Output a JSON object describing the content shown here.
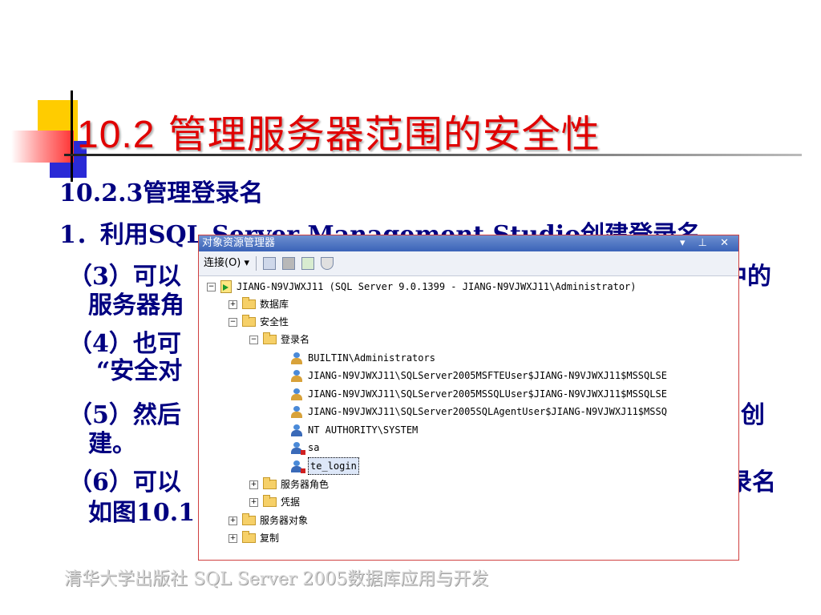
{
  "slide": {
    "title_num": "10.2",
    "title_text": "管理服务器范围的安全性",
    "subhead": "10.2.3管理登录名",
    "line1": "1．利用SQL Server Management Studio创建登录名",
    "p3_prefix": "（3）可以",
    "p3_suffix": "中的",
    "p3_line2": "服务器角",
    "p4_prefix": "（4）也可",
    "p4_line2": "“安全对",
    "p5_prefix": "（5）然后",
    "p5_suffix": "创",
    "p5_line2": "建。",
    "p6_prefix": "（6）可以",
    "p6_suffix": "录名",
    "p6_line2": "如图10.1",
    "footer": "清华大学出版社 SQL Server 2005数据库应用与开发"
  },
  "object_explorer": {
    "title": "对象资源管理器",
    "title_buttons": "▾ ⊥ ✕",
    "toolbar": {
      "connect_label": "连接(O) ▾",
      "icons": [
        "connect-server-icon",
        "disconnect-icon",
        "stop-icon",
        "refresh-icon",
        "filter-icon"
      ]
    },
    "tree": {
      "server": "JIANG-N9VJWXJ11 (SQL Server 9.0.1399 - JIANG-N9VJWXJ11\\Administrator)",
      "databases": "数据库",
      "security": "安全性",
      "logins": "登录名",
      "login_items": [
        "BUILTIN\\Administrators",
        "JIANG-N9VJWXJ11\\SQLServer2005MSFTEUser$JIANG-N9VJWXJ11$MSSQLSE",
        "JIANG-N9VJWXJ11\\SQLServer2005MSSQLUser$JIANG-N9VJWXJ11$MSSQLSE",
        "JIANG-N9VJWXJ11\\SQLServer2005SQLAgentUser$JIANG-N9VJWXJ11$MSSQ",
        "NT AUTHORITY\\SYSTEM",
        "sa",
        "te_login"
      ],
      "server_roles": "服务器角色",
      "credentials": "凭据",
      "server_objects": "服务器对象",
      "replication": "复制"
    }
  },
  "colors": {
    "title": "#e00000",
    "body_text": "#000080",
    "accent_yellow": "#ffcc00",
    "accent_blue": "#2a2ad6"
  }
}
